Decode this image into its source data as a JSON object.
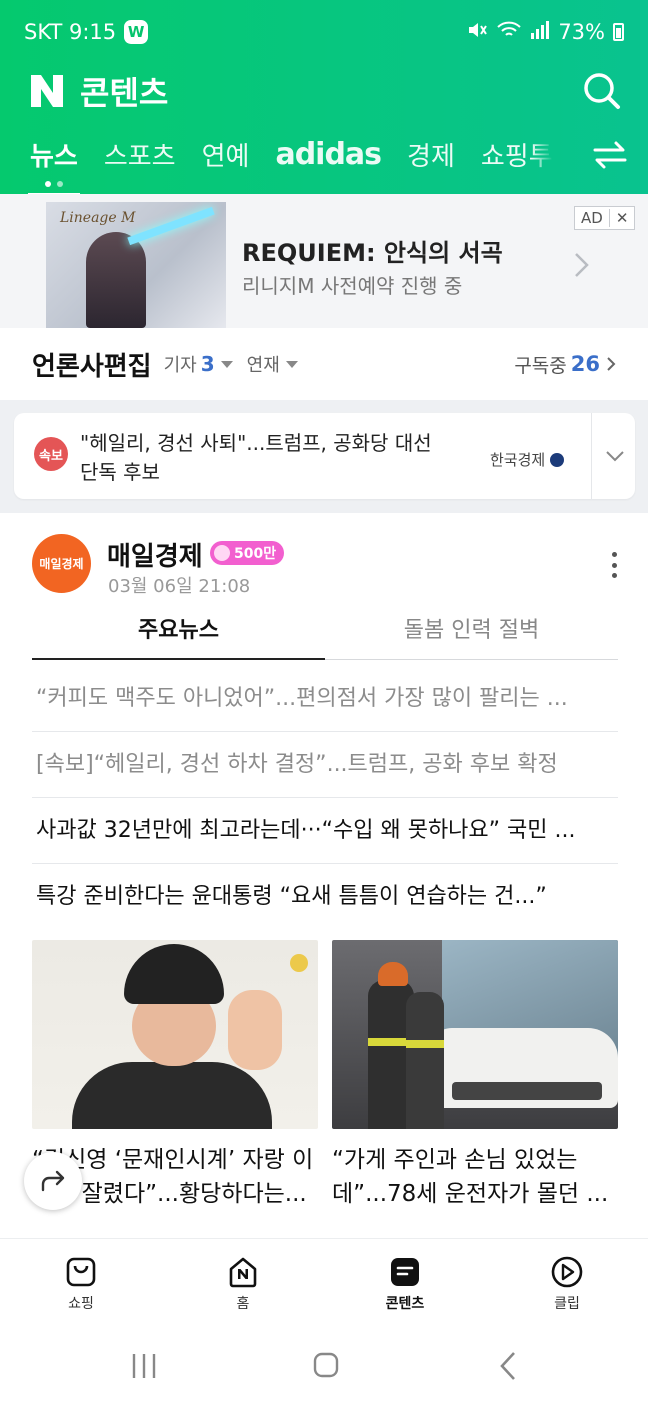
{
  "status_bar": {
    "carrier_time": "SKT 9:15",
    "app_badge": "W",
    "battery": "73%"
  },
  "header": {
    "logo_letter": "N",
    "title": "콘텐츠",
    "tabs": [
      {
        "label": "뉴스",
        "active": true
      },
      {
        "label": "스포츠"
      },
      {
        "label": "연예"
      },
      {
        "label": "adidas"
      },
      {
        "label": "경제"
      },
      {
        "label": "쇼핑투"
      }
    ]
  },
  "ad": {
    "logo": "Lineage M",
    "title": "REQUIEM: 안식의 서곡",
    "subtitle": "리니지M 사전예약 진행 중",
    "badge": "AD",
    "close": "✕"
  },
  "press_edit": {
    "title": "언론사편집",
    "reporter_label": "기자",
    "reporter_count": "3",
    "series_label": "연재",
    "subscribed_label": "구독중",
    "subscribed_count": "26"
  },
  "breaking": {
    "badge": "속보",
    "text": "\"헤일리, 경선 사퇴\"...트럼프, 공화당 대선 단독 후보",
    "source": "한국경제"
  },
  "publisher": {
    "logo_text": "매일경제",
    "name": "매일경제",
    "badge": "500만",
    "datetime": "03월 06일 21:08",
    "tabs": [
      "주요뉴스",
      "돌봄 인력 절벽"
    ],
    "headlines": [
      {
        "text": "“커피도 맥주도 아니었어”...편의점서 가장 많이 팔리는 ...",
        "read": true
      },
      {
        "text": "[속보]“헤일리, 경선 하차 결정”...트럼프, 공화 후보 확정",
        "read": true
      },
      {
        "text": "사과값 32년만에 최고라는데···“수입 왜 못하나요” 국민 ...",
        "read": false
      },
      {
        "text": "특강 준비한다는 윤대통령 “요새 틈틈이 연습하는 건...”",
        "read": false
      }
    ],
    "cards": [
      {
        "title": "“김신영 ‘문재인시계’ 자랑 이유로 잘렸다”...황당하다는..."
      },
      {
        "title": "“가게 주인과 손님 있었는데”...78세 운전자가 몰던 ..."
      }
    ]
  },
  "tabbar": {
    "items": [
      {
        "label": "쇼핑",
        "icon": "shopping-bag-icon"
      },
      {
        "label": "홈",
        "icon": "home-icon"
      },
      {
        "label": "콘텐츠",
        "icon": "contents-icon",
        "active": true
      },
      {
        "label": "클립",
        "icon": "clip-play-icon"
      }
    ]
  },
  "colors": {
    "brand_green": "#05c96e",
    "accent_blue": "#3b6fc9",
    "breaking_red": "#e45556",
    "publisher_orange": "#f26522",
    "badge_pink": "#f25fcf"
  }
}
